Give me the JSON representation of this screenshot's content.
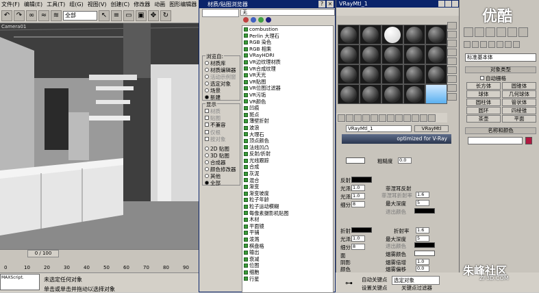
{
  "menubar": {
    "items": [
      "文件(F)",
      "编辑(E)",
      "工具(T)",
      "组(G)",
      "视图(V)",
      "创建(C)",
      "修改器",
      "动画",
      "图形编辑器"
    ]
  },
  "toolbar": {
    "selection_filter": "全部"
  },
  "viewport": {
    "label": "Camera01"
  },
  "timeline": {
    "frame_readout": "0 / 100",
    "ticks": [
      "0",
      "10",
      "20",
      "30",
      "40",
      "50",
      "60",
      "70",
      "80",
      "90"
    ]
  },
  "status": {
    "script_label": "MAXScript.",
    "prompt_line1": "未选定任何对象",
    "prompt_line2": "单击或单击并拖动以选择对象"
  },
  "material_browser": {
    "title": "材质/贴图浏览器",
    "search": "无",
    "browse_from": {
      "title": "浏览自:",
      "options": [
        "材质库",
        "材质编辑器",
        "活动示例窗",
        "选定对象",
        "场景",
        "新建"
      ],
      "disabled": [
        false,
        false,
        true,
        false,
        false,
        false
      ],
      "selected": "新建"
    },
    "show": {
      "title": "显示",
      "checks": [
        "材质",
        "贴图",
        "不兼容"
      ],
      "checks_disabled": [
        true,
        true,
        false
      ],
      "checks2": [
        "仅根",
        "按对象"
      ],
      "radios": [
        "2D 贴图",
        "3D 贴图",
        "合成器",
        "颜色修改器",
        "其他",
        "全部"
      ],
      "selected": "全部"
    },
    "items": [
      "combustion",
      "Perlin 大理石",
      "RGB 染色",
      "RGB 相乘",
      "VRayHDRI",
      "VR边纹理材质",
      "VR合成纹理",
      "VR天光",
      "VR贴图",
      "VR位图过滤器",
      "VR污垢",
      "VR颜色",
      "凹痕",
      "斑点",
      "薄壁折射",
      "波浪",
      "大理石",
      "顶点颜色",
      "法线凹凸",
      "反射/折射",
      "光线跟踪",
      "合成",
      "灰泥",
      "混合",
      "渐变",
      "渐变坡度",
      "粒子年龄",
      "粒子运动模糊",
      "每像素摄影机贴图",
      "木材",
      "平面镜",
      "平铺",
      "泼溅",
      "棋盘格",
      "输出",
      "衰减",
      "位图",
      "细胞",
      "行星"
    ]
  },
  "material_editor": {
    "title": "VRayMtl_1",
    "material_name": "VRayMtl_1",
    "material_type": "VRayMtl",
    "banner_text": "optimized for V-Ray",
    "params": {
      "roughness_label": "粗糙度",
      "roughness_value": "0.0",
      "reflect_label": "反射",
      "gloss_label": "光泽度",
      "gloss_value": "1.0",
      "subdiv_label": "细分",
      "subdiv_value": "8",
      "fresnel_label": "菲涅耳反射",
      "fresnel_ior_label": "菲涅耳折射率",
      "fresnel_ior_value": "1.6",
      "max_depth_label": "最大深度",
      "max_depth_value": "5",
      "exit_color_label": "退出颜色",
      "refract_label": "折射",
      "ior_label": "折射率",
      "ior_value": "1.6",
      "max_depth2_value": "5",
      "fog_color_label": "烟雾颜色",
      "fog_mult_label": "烟雾倍增",
      "fog_mult_value": "1.0",
      "fog_bias_label": "烟雾偏移",
      "fog_bias_value": "0.0",
      "env_label": "面",
      "shadow_label": "阴影",
      "opt_label": "颜色"
    }
  },
  "command_panel": {
    "dropdown": "标准基本体",
    "rollout_object_type": "对象类型",
    "autogrid": "自动栅格",
    "buttons": [
      "长方体",
      "圆锥体",
      "球体",
      "几何球体",
      "圆柱体",
      "管状体",
      "圆环",
      "四棱锥",
      "茶壶",
      "平面"
    ],
    "rollout_name_color": "名称和颜色",
    "color": "#b01840"
  },
  "bottom_controls": {
    "auto_key": "自动关键点",
    "set_key": "设置关键点",
    "selected": "选定对象",
    "key_filters": "关键点过滤器"
  },
  "watermarks": {
    "top": "优酷",
    "bottom": "朱峰社区",
    "bottom_url": "ZF3D.COM"
  }
}
